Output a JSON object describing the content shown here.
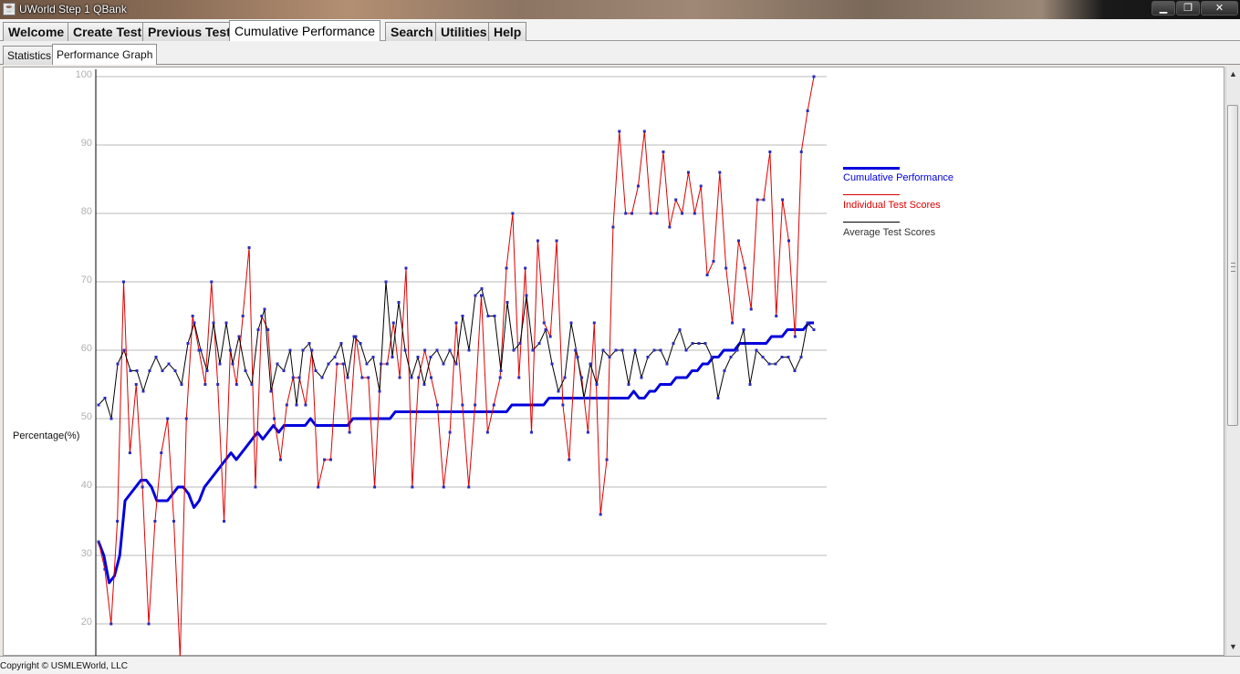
{
  "window": {
    "title": "UWorld Step 1 QBank",
    "app_icon": "java-icon",
    "controls": [
      "minimize-icon",
      "restore-icon",
      "close-icon"
    ]
  },
  "menu_tabs": [
    "Welcome",
    "Create Test",
    "Previous Test",
    "Cumulative Performance",
    "Search",
    "Utilities",
    "Help"
  ],
  "active_menu_tab": "Cumulative Performance",
  "sub_tabs": [
    "Statistics",
    "Performance Graph"
  ],
  "active_sub_tab": "Performance Graph",
  "footer": {
    "copyright": "Copyright © USMLEWorld, LLC"
  },
  "colors": {
    "cumulative": "#0000dd",
    "individual": "#dd0000",
    "average": "#000000",
    "markers": "#2c2cb8",
    "grid": "#b8b8b8",
    "tick_text": "#b0b0b0"
  },
  "chart_data": {
    "type": "line",
    "ylabel": "Percentage(%)",
    "ylim": [
      15,
      100
    ],
    "yticks": [
      20,
      30,
      40,
      50,
      60,
      70,
      80,
      90,
      100
    ],
    "grid": true,
    "legend_position": "right",
    "series": [
      {
        "name": "Cumulative Performance",
        "values": [
          32,
          30,
          26,
          27,
          30,
          38,
          39,
          40,
          41,
          41,
          40,
          38,
          38,
          38,
          39,
          40,
          40,
          39,
          37,
          38,
          40,
          41,
          42,
          43,
          44,
          45,
          44,
          45,
          46,
          47,
          48,
          47,
          48,
          49,
          48,
          49,
          49,
          49,
          49,
          49,
          50,
          49,
          49,
          49,
          49,
          49,
          49,
          49,
          50,
          50,
          50,
          50,
          50,
          50,
          50,
          50,
          51,
          51,
          51,
          51,
          51,
          51,
          51,
          51,
          51,
          51,
          51,
          51,
          51,
          51,
          51,
          51,
          51,
          51,
          51,
          51,
          51,
          51,
          52,
          52,
          52,
          52,
          52,
          52,
          52,
          53,
          53,
          53,
          53,
          53,
          53,
          53,
          53,
          53,
          53,
          53,
          53,
          53,
          53,
          53,
          53,
          54,
          53,
          53,
          54,
          54,
          55,
          55,
          55,
          56,
          56,
          56,
          57,
          57,
          58,
          58,
          59,
          59,
          60,
          60,
          60,
          61,
          61,
          61,
          61,
          61,
          61,
          62,
          62,
          62,
          63,
          63,
          63,
          63,
          64,
          64
        ]
      },
      {
        "name": "Individual Test Scores",
        "values": [
          32,
          28,
          20,
          35,
          70,
          45,
          55,
          40,
          20,
          35,
          45,
          50,
          35,
          15,
          50,
          65,
          60,
          55,
          70,
          55,
          35,
          60,
          55,
          65,
          75,
          40,
          65,
          63,
          50,
          44,
          52,
          56,
          56,
          52,
          60,
          40,
          44,
          44,
          58,
          58,
          48,
          62,
          56,
          56,
          40,
          58,
          58,
          64,
          56,
          72,
          40,
          56,
          60,
          56,
          52,
          40,
          48,
          64,
          52,
          40,
          52,
          68,
          48,
          52,
          56,
          72,
          80,
          56,
          72,
          48,
          76,
          64,
          62,
          76,
          52,
          44,
          60,
          56,
          48,
          64,
          36,
          44,
          78,
          92,
          80,
          80,
          84,
          92,
          80,
          80,
          89,
          78,
          82,
          80,
          86,
          80,
          84,
          71,
          73,
          86,
          72,
          64,
          76,
          72,
          66,
          82,
          82,
          89,
          65,
          82,
          76,
          62,
          89,
          95,
          100
        ]
      },
      {
        "name": "Average Test Scores",
        "values": [
          52,
          53,
          50,
          58,
          60,
          57,
          57,
          54,
          57,
          59,
          57,
          58,
          57,
          55,
          61,
          64,
          60,
          57,
          64,
          58,
          64,
          58,
          62,
          57,
          55,
          63,
          66,
          54,
          58,
          57,
          60,
          52,
          60,
          61,
          57,
          56,
          58,
          59,
          61,
          56,
          62,
          61,
          58,
          59,
          54,
          70,
          59,
          67,
          60,
          56,
          59,
          55,
          59,
          60,
          58,
          60,
          58,
          65,
          60,
          68,
          69,
          65,
          65,
          57,
          67,
          60,
          61,
          68,
          60,
          61,
          63,
          58,
          54,
          56,
          64,
          59,
          53,
          58,
          55,
          60,
          59,
          60,
          60,
          55,
          60,
          56,
          59,
          60,
          60,
          58,
          61,
          63,
          60,
          61,
          61,
          61,
          59,
          53,
          57,
          59,
          60,
          63,
          55,
          60,
          59,
          58,
          58,
          59,
          59,
          57,
          59,
          64,
          63
        ]
      }
    ]
  }
}
